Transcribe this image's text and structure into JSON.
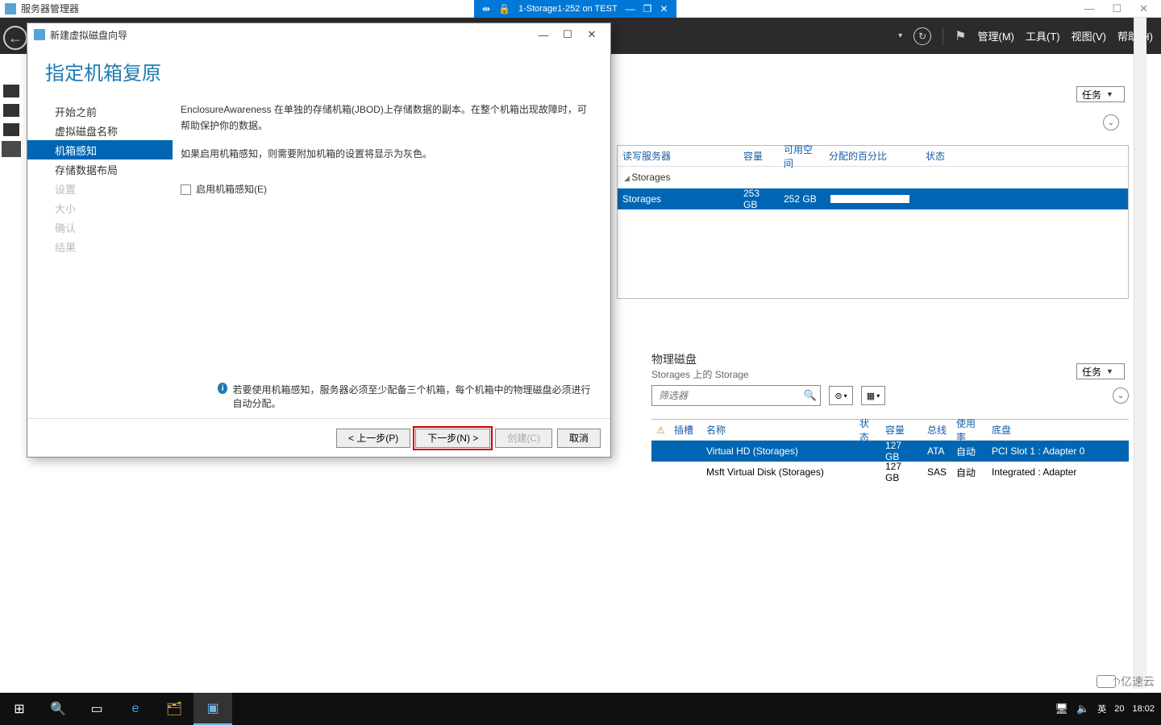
{
  "host_window": {
    "app_title": "服务器管理器",
    "vm_title": "1-Storage1-252 on TEST",
    "controls": {
      "min": "—",
      "max": "☐",
      "close": "✕"
    }
  },
  "sm_header": {
    "menu": {
      "manage": "管理(M)",
      "tools": "工具(T)",
      "view": "视图(V)",
      "help": "帮助(H)"
    },
    "refresh_glyph": "↻",
    "flag_glyph": "⚑"
  },
  "tasks_label": "任务",
  "pool_table": {
    "headers": {
      "rw": "读写服务器",
      "capacity": "容量",
      "free": "可用空间",
      "pct": "分配的百分比",
      "status": "状态"
    },
    "group": "Storages",
    "row": {
      "name": "Storages",
      "capacity": "253 GB",
      "free": "252 GB"
    }
  },
  "phys": {
    "title": "物理磁盘",
    "subtitle": "Storages 上的 Storage",
    "filter_placeholder": "筛选器",
    "headers": {
      "slot": "插槽",
      "name": "名称",
      "status": "状态",
      "capacity": "容量",
      "bus": "总线",
      "usage": "使用率",
      "bay": "底盘"
    },
    "rows": [
      {
        "name": "Virtual HD (Storages)",
        "capacity": "127 GB",
        "bus": "ATA",
        "usage": "自动",
        "bay": "PCI Slot 1 : Adapter 0"
      },
      {
        "name": "Msft Virtual Disk (Storages)",
        "capacity": "127 GB",
        "bus": "SAS",
        "usage": "自动",
        "bay": "Integrated : Adapter"
      }
    ]
  },
  "wizard": {
    "title": "新建虚拟磁盘向导",
    "heading": "指定机箱复原",
    "win_ctrl": {
      "min": "—",
      "max": "☐",
      "close": "✕"
    },
    "steps": {
      "before": "开始之前",
      "vdname": "虚拟磁盘名称",
      "enclosure": "机箱感知",
      "layout": "存储数据布局",
      "settings": "设置",
      "size": "大小",
      "confirm": "确认",
      "result": "结果"
    },
    "desc1": "EnclosureAwareness 在单独的存储机箱(JBOD)上存储数据的副本。在整个机箱出现故障时，可帮助保护你的数据。",
    "desc2": "如果启用机箱感知，则需要附加机箱的设置将显示为灰色。",
    "checkbox": "启用机箱感知(E)",
    "note": "若要使用机箱感知，服务器必须至少配备三个机箱，每个机箱中的物理磁盘必须进行自动分配。",
    "buttons": {
      "prev": "< 上一步(P)",
      "next": "下一步(N) >",
      "create": "创建(C)",
      "cancel": "取消"
    }
  },
  "taskbar": {
    "tray": {
      "ime": "英",
      "time": "18:02",
      "date_prefix": "20"
    }
  },
  "watermark": "亿速云"
}
